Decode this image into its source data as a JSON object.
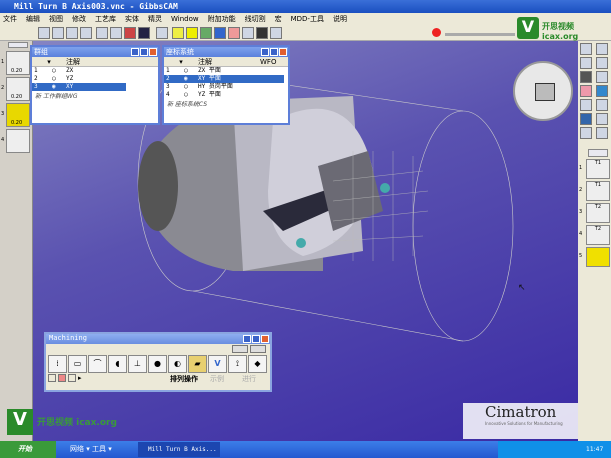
{
  "window": {
    "title": "Mill Turn B Axis003.vnc - GibbsCAM"
  },
  "menu": [
    "文件",
    "编辑",
    "视图",
    "修改",
    "工艺库",
    "实体",
    "精灵",
    "Window",
    "附加功能",
    "线切割",
    "宏",
    "MDD-工具",
    "说明"
  ],
  "left_panel": {
    "slots": [
      {
        "num": "1",
        "label": "0.20"
      },
      {
        "num": "2",
        "label": "0.20"
      },
      {
        "num": "3",
        "label": "0.20"
      },
      {
        "num": "4",
        "label": ""
      }
    ]
  },
  "groups_window": {
    "title": "群组",
    "col_annotation": "注解",
    "rows": [
      {
        "num": "1",
        "name": "ZX"
      },
      {
        "num": "2",
        "name": "YZ"
      },
      {
        "num": "3",
        "name": "XY",
        "selected": true
      }
    ],
    "footer": "新 工作群组WG"
  },
  "cs_window": {
    "title": "座标系统",
    "col_annotation": "注解",
    "col_wfo": "WFO",
    "rows": [
      {
        "num": "1",
        "name": "ZX 平面"
      },
      {
        "num": "2",
        "name": "XY 平面",
        "selected": true
      },
      {
        "num": "3",
        "name": "HY 员岗平面"
      },
      {
        "num": "4",
        "name": "YZ 平面"
      }
    ],
    "footer": "新 座标系统CS"
  },
  "right_panel": {
    "ops": [
      {
        "num": "1",
        "label": "T1"
      },
      {
        "num": "2",
        "label": "T1"
      },
      {
        "num": "3",
        "label": "T2"
      },
      {
        "num": "4",
        "label": "T2"
      },
      {
        "num": "5",
        "label": ""
      }
    ]
  },
  "machining": {
    "title": "Machining",
    "tabs": [
      "排列操作",
      "示例",
      "进行"
    ]
  },
  "watermarks": {
    "top": "开思视频 icax.org",
    "bottom": "开思视频 icax.org",
    "brand": "Cimatron",
    "brand_tag": "Innovative Solutions for Manufacturing"
  },
  "taskbar": {
    "start": "开始",
    "links": "网络 ▾ 工具 ▾",
    "task": "Mill Turn B Axis...",
    "clock": "11:47"
  },
  "colors": {
    "accent": "#316ac5",
    "highlight": "#f0e000"
  }
}
